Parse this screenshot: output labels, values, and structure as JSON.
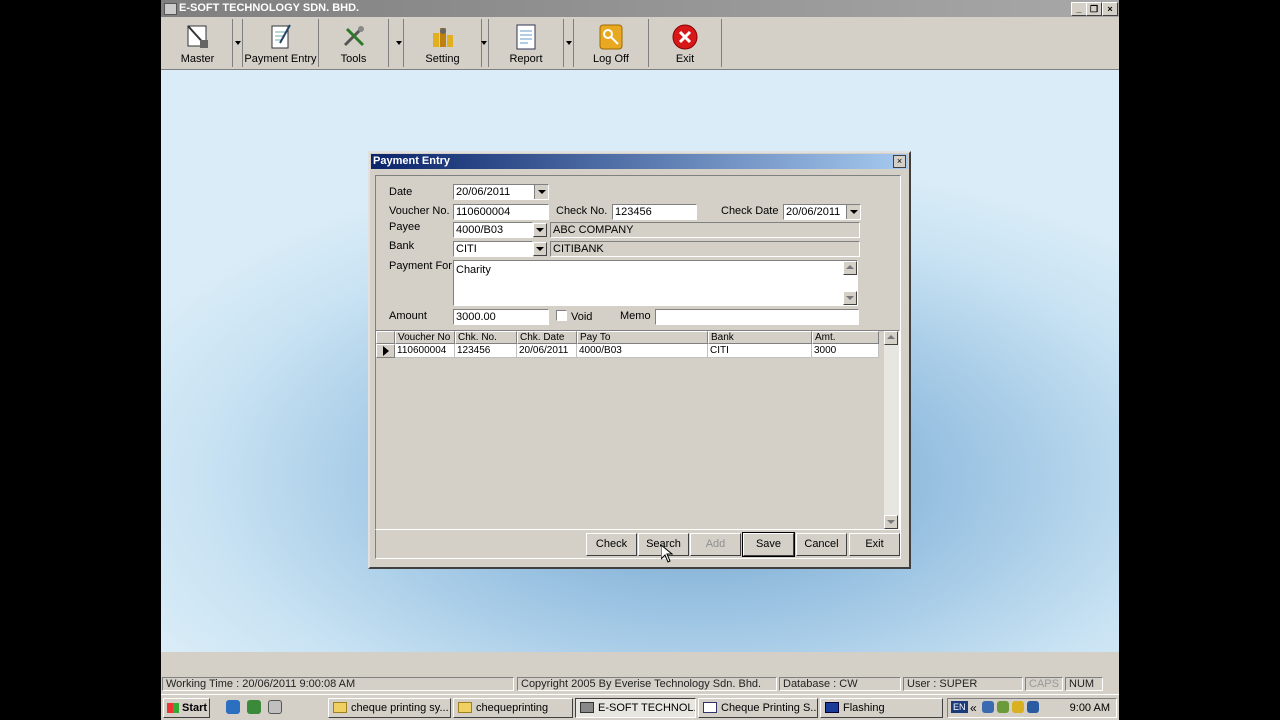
{
  "app": {
    "title": "E-SOFT TECHNOLOGY SDN. BHD."
  },
  "toolbar": {
    "items": [
      {
        "label": "Master"
      },
      {
        "label": "Payment Entry"
      },
      {
        "label": "Tools"
      },
      {
        "label": "Setting"
      },
      {
        "label": "Report"
      },
      {
        "label": "Log Off"
      },
      {
        "label": "Exit"
      }
    ]
  },
  "dialog": {
    "title": "Payment Entry",
    "labels": {
      "date": "Date",
      "voucher_no": "Voucher No.",
      "check_no": "Check No.",
      "check_date": "Check Date",
      "payee": "Payee",
      "bank": "Bank",
      "payment_for": "Payment For",
      "amount": "Amount",
      "void": "Void",
      "memo": "Memo"
    },
    "values": {
      "date": "20/06/2011",
      "voucher_no": "110600004",
      "check_no": "123456",
      "check_date": "20/06/2011",
      "payee_code": "4000/B03",
      "payee_name": "ABC COMPANY",
      "bank_code": "CITI",
      "bank_name": "CITIBANK",
      "payment_for": "Charity",
      "amount": "3000.00",
      "memo": ""
    },
    "grid": {
      "columns": [
        "Voucher No",
        "Chk. No.",
        "Chk. Date",
        "Pay To",
        "Bank",
        "Amt."
      ],
      "rows": [
        [
          "110600004",
          "123456",
          "20/06/2011",
          "4000/B03",
          "CITI",
          "3000"
        ]
      ]
    },
    "buttons": {
      "check": "Check",
      "search": "Search",
      "add": "Add",
      "save": "Save",
      "cancel": "Cancel",
      "exit": "Exit"
    }
  },
  "status": {
    "working_time": "Working Time : 20/06/2011  9:00:08 AM",
    "copyright": "Copyright 2005 By Everise Technology Sdn. Bhd.",
    "database": "Database : CW",
    "user": "User : SUPER",
    "caps": "CAPS",
    "num": "NUM"
  },
  "taskbar": {
    "start": "Start",
    "tasks": [
      {
        "label": "cheque printing sy..."
      },
      {
        "label": "chequeprinting"
      },
      {
        "label": "E-SOFT TECHNOL..."
      },
      {
        "label": "Cheque Printing S..."
      },
      {
        "label": "Flashing"
      }
    ],
    "lang": "EN",
    "clock": "9:00 AM"
  }
}
